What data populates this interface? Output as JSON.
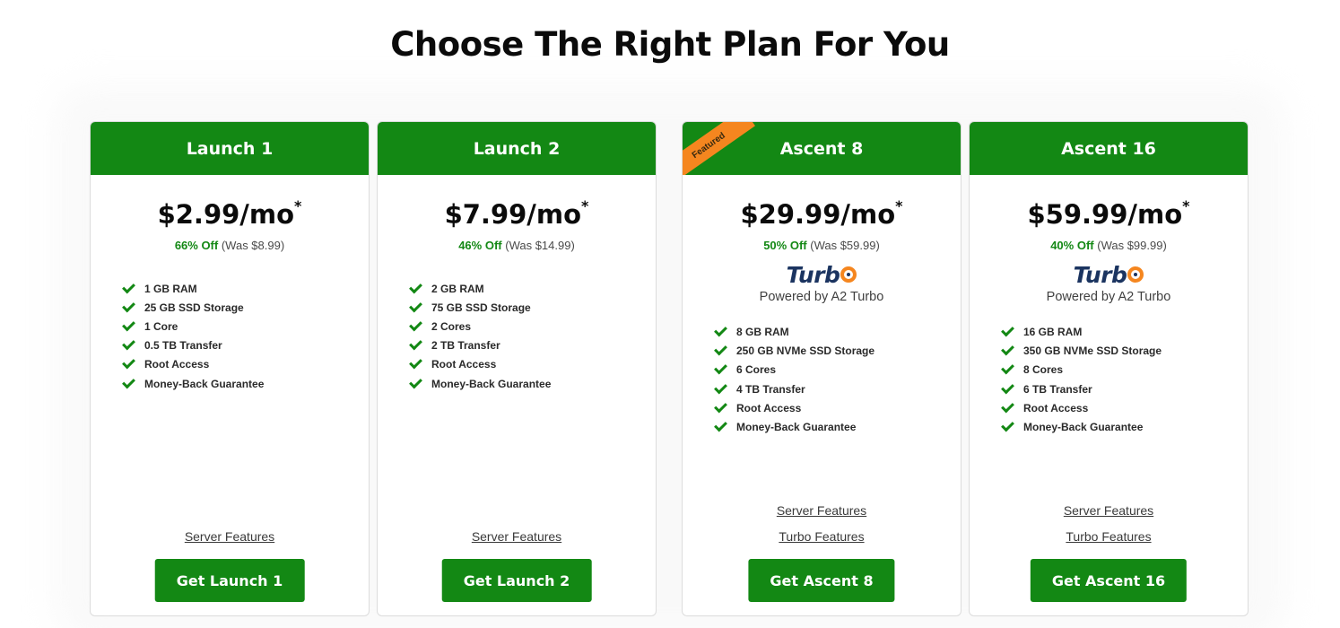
{
  "page": {
    "title": "Choose The Right Plan For You"
  },
  "plans": [
    {
      "name": "Launch 1",
      "price": "$2.99/mo",
      "asterisk": "*",
      "discount": "66% Off",
      "was": "(Was $8.99)",
      "features": [
        "1 GB RAM",
        "25 GB SSD Storage",
        "1 Core",
        "0.5 TB Transfer",
        "Root Access",
        "Money-Back Guarantee"
      ],
      "links": [
        "Server Features"
      ],
      "button": "Get Launch 1"
    },
    {
      "name": "Launch 2",
      "price": "$7.99/mo",
      "asterisk": "*",
      "discount": "46% Off",
      "was": "(Was $14.99)",
      "features": [
        "2 GB RAM",
        "75 GB SSD Storage",
        "2 Cores",
        "2 TB Transfer",
        "Root Access",
        "Money-Back Guarantee"
      ],
      "links": [
        "Server Features"
      ],
      "button": "Get Launch 2"
    },
    {
      "name": "Ascent 8",
      "ribbon": "Featured",
      "price": "$29.99/mo",
      "asterisk": "*",
      "discount": "50% Off",
      "was": "(Was $59.99)",
      "turbo_logo": "Turb",
      "turbo_caption": "Powered by A2 Turbo",
      "features": [
        "8 GB RAM",
        "250 GB NVMe SSD Storage",
        "6 Cores",
        "4 TB Transfer",
        "Root Access",
        "Money-Back Guarantee"
      ],
      "links": [
        "Server Features",
        "Turbo Features"
      ],
      "button": "Get Ascent 8"
    },
    {
      "name": "Ascent 16",
      "price": "$59.99/mo",
      "asterisk": "*",
      "discount": "40% Off",
      "was": "(Was $99.99)",
      "turbo_logo": "Turb",
      "turbo_caption": "Powered by A2 Turbo",
      "features": [
        "16 GB RAM",
        "350 GB NVMe SSD Storage",
        "8 Cores",
        "6 TB Transfer",
        "Root Access",
        "Money-Back Guarantee"
      ],
      "links": [
        "Server Features",
        "Turbo Features"
      ],
      "button": "Get Ascent 16"
    }
  ],
  "colors": {
    "brand_green": "#138814",
    "ribbon_orange": "#f5861f",
    "turbo_navy": "#1b3460"
  },
  "icons": {
    "feature_bullet": "check-icon"
  }
}
